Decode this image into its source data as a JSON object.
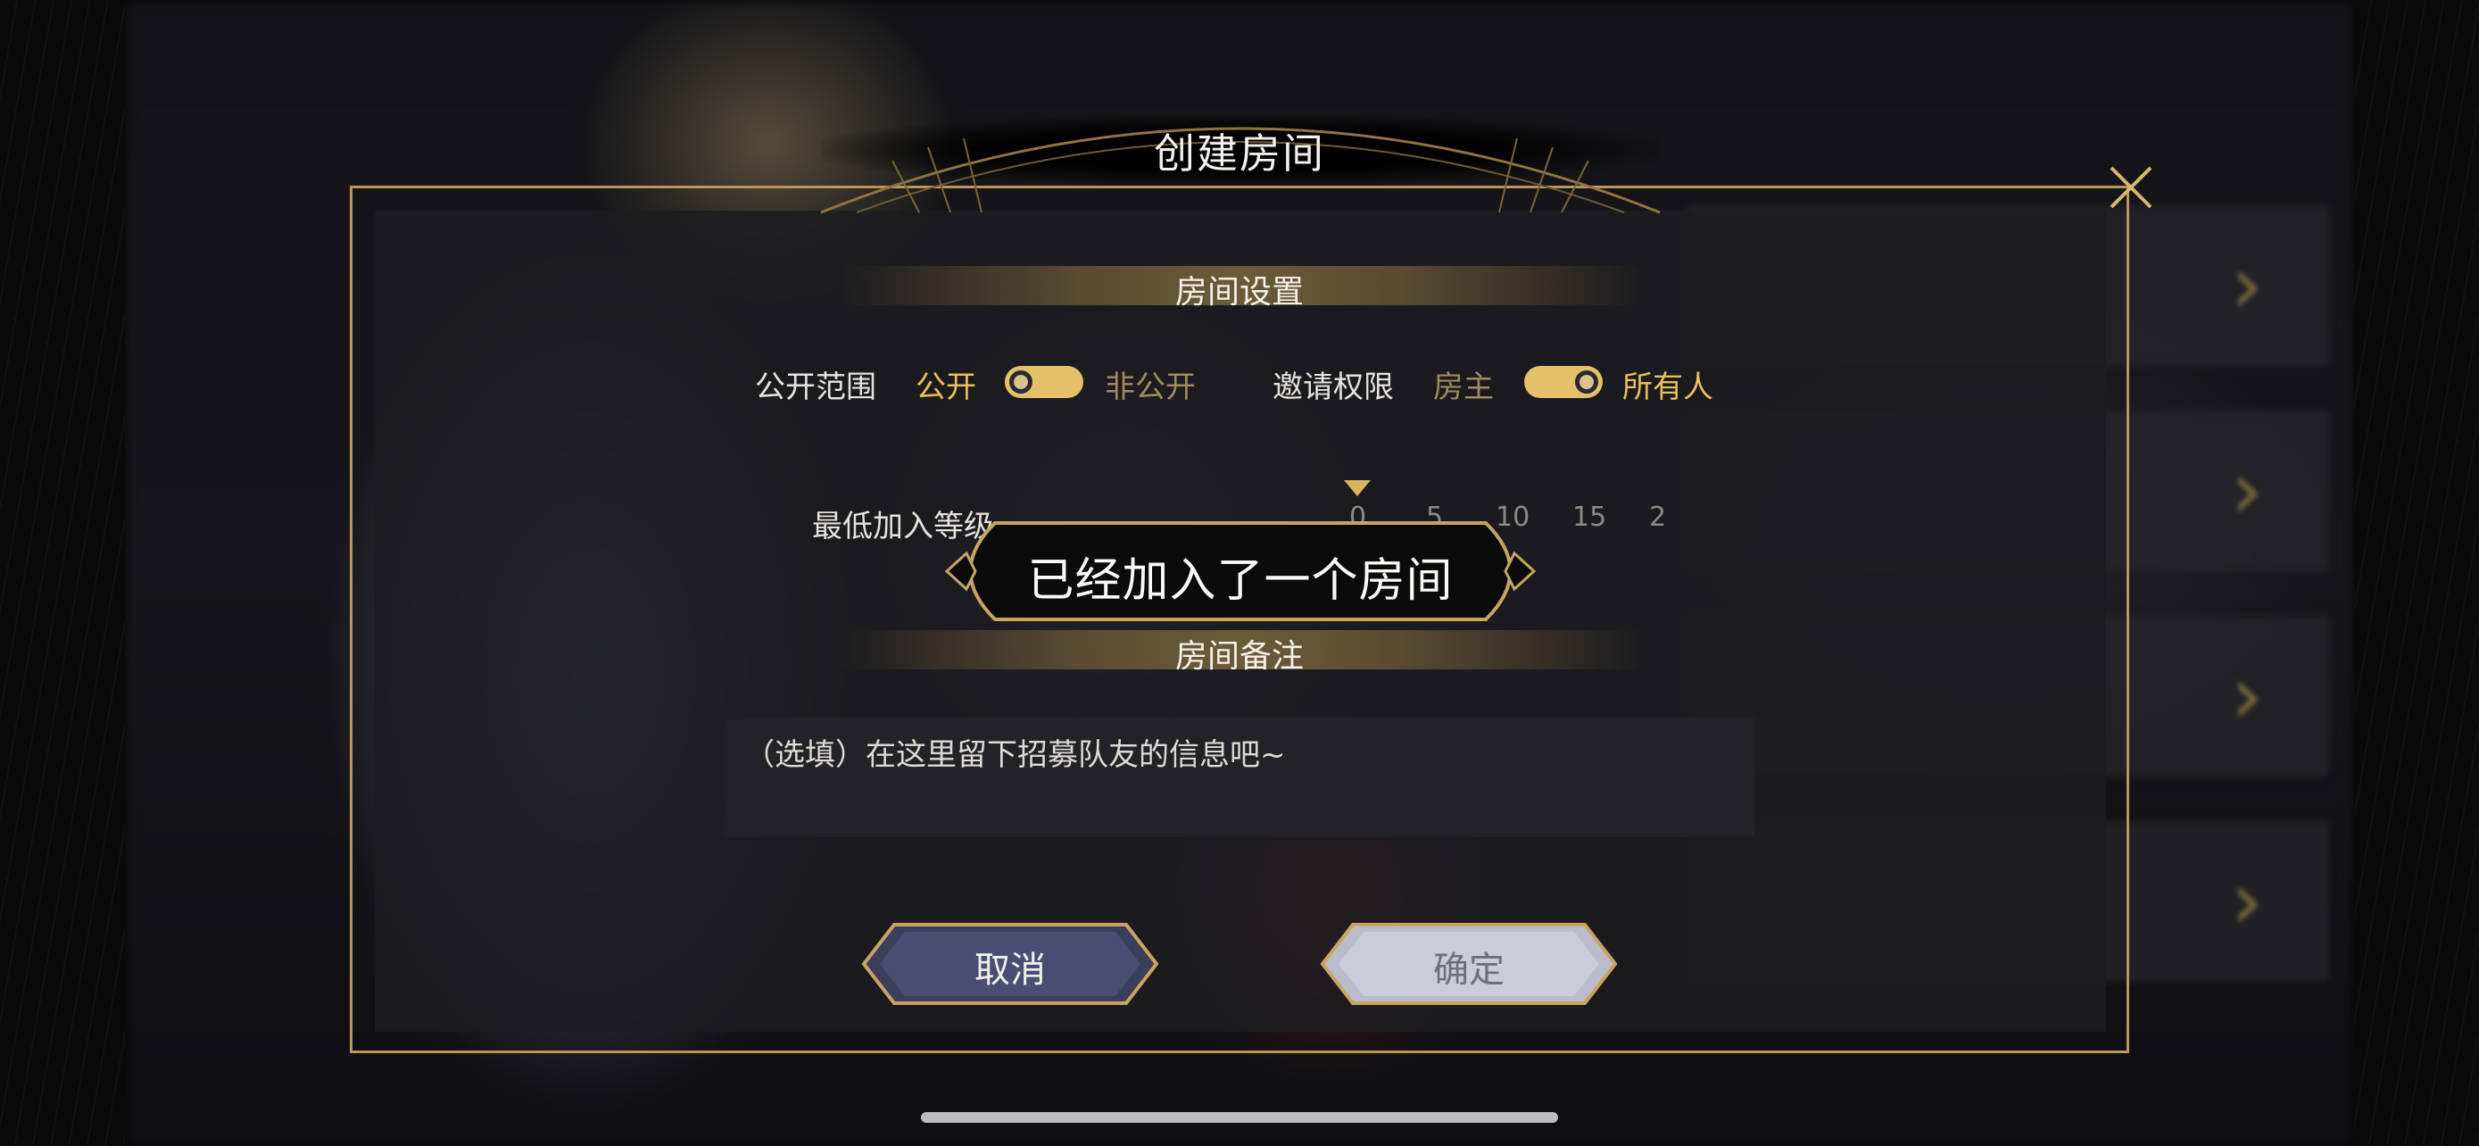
{
  "dialog": {
    "title": "创建房间",
    "close_icon": "close-icon"
  },
  "room_settings": {
    "section_title": "房间设置",
    "visibility": {
      "label": "公开范围",
      "option_public": "公开",
      "option_private": "非公开",
      "selected": "公开"
    },
    "invite_permission": {
      "label": "邀请权限",
      "option_owner": "房主",
      "option_everyone": "所有人",
      "selected": "所有人"
    },
    "min_level": {
      "label": "最低加入等级",
      "ticks": [
        "0",
        "5",
        "10",
        "15",
        "2"
      ],
      "selected": "0"
    }
  },
  "toast": {
    "message": "已经加入了一个房间"
  },
  "room_note": {
    "section_title": "房间备注",
    "placeholder": "（选填）在这里留下招募队友的信息吧~"
  },
  "buttons": {
    "cancel": "取消",
    "confirm": "确定"
  },
  "colors": {
    "accent_gold": "#e8c15a",
    "frame_gold": "#b9975b",
    "inactive_gold": "#a08b60"
  }
}
